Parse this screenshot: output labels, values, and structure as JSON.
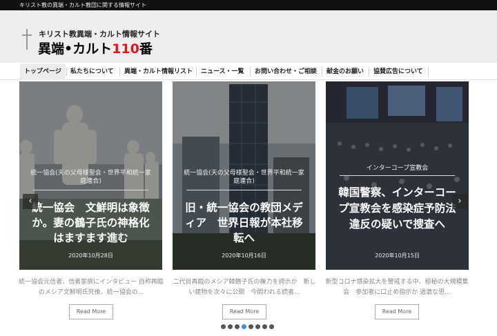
{
  "topbar": {
    "text": "キリスト教の異端・カルト教団に関する情報サイト"
  },
  "header": {
    "tagline": "キリスト教異端・カルト情報サイト",
    "title_main": "異端•カルト",
    "title_num": "110",
    "title_end": "番"
  },
  "nav": {
    "items": [
      {
        "label": "トップページ"
      },
      {
        "label": "私たちについて"
      },
      {
        "label": "異端・カルト情報リスト"
      },
      {
        "label": "ニュース・一覧"
      },
      {
        "label": "お問い合わせ・ご相談"
      },
      {
        "label": "献金のお願い"
      },
      {
        "label": "協賛広告について"
      }
    ]
  },
  "slides": [
    {
      "category": "統一協会(天の父母様聖会・世界平和統一家庭連合)",
      "title": "統一協会　文鮮明は象徴か。妻の鶴子氏の神格化はますます進む",
      "date": "2020年10月28日",
      "excerpt": "統一協会元信者、信者家族にインタビュー 自称再臨のメシア文鮮明氏死後、統一協会の...",
      "button": "Read More"
    },
    {
      "category": "統一協会(天の父母様聖会・世界平和統一家庭連合)",
      "title": "旧・統一協会の教団メディア　世界日報が本社移転へ",
      "date": "2020年10月16日",
      "excerpt": "二代目再臨のメシア韓鶴子氏の権力を誇示か　新しい建物を次々に公開　今問われる読者...",
      "button": "Read More"
    },
    {
      "category": "インターコープ宣教会",
      "title": "韓国警察、インターコープ宣教会を感染症予防法違反の疑いで捜査へ",
      "date": "2020年10月15日",
      "excerpt": "新型コロナ感染拡大を警戒する中、極秘の大規模集会　参加者に口止め指示か 過激な思...",
      "button": "Read More"
    }
  ],
  "carousel": {
    "dot_count": 8,
    "active_index": 3
  },
  "colors": {
    "accent_red": "#e0161d",
    "dot_active": "#3a8ee6"
  },
  "icons": {
    "prev": "chevron-left-icon",
    "next": "chevron-right-icon",
    "logo": "cross-icon"
  }
}
